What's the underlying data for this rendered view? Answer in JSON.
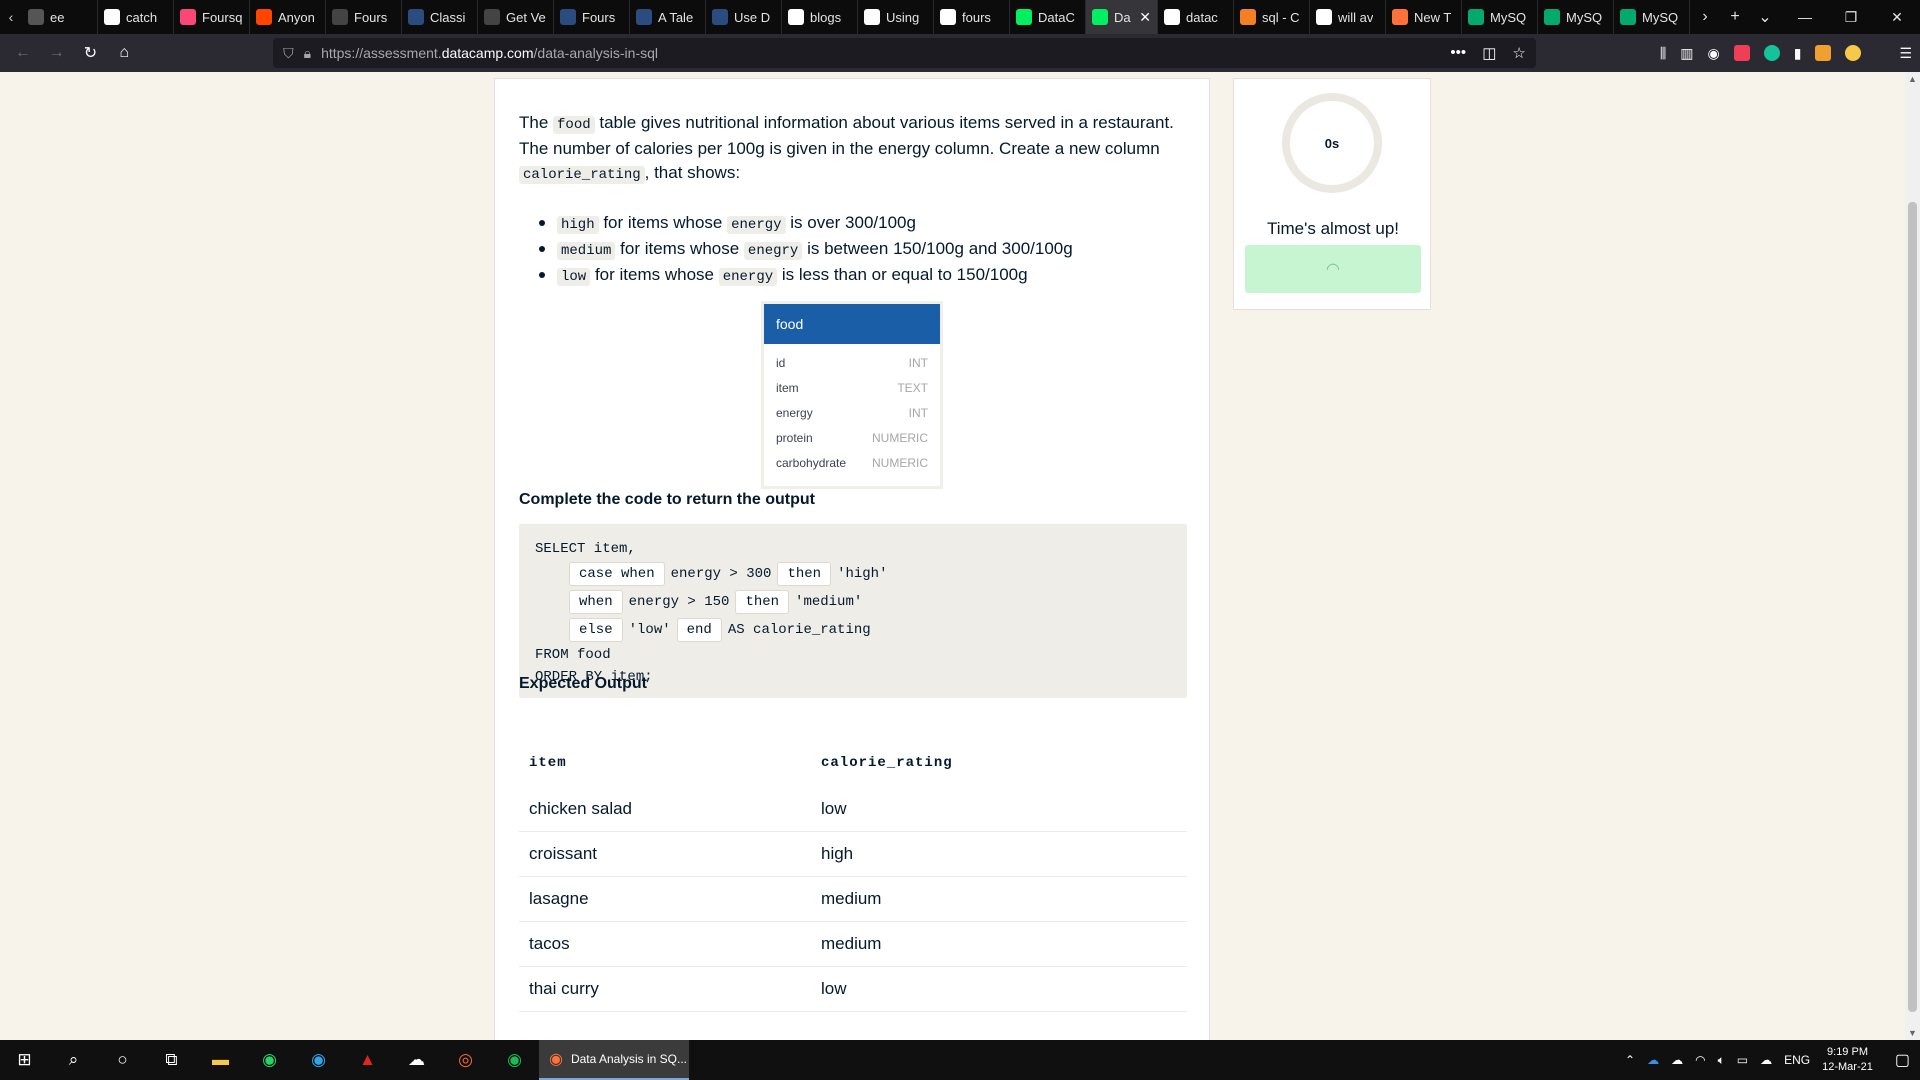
{
  "browser": {
    "tabs": [
      {
        "label": "ee",
        "icon": "generic-icon",
        "color": "#555555"
      },
      {
        "label": "catch",
        "icon": "google-icon",
        "color": "#ffffff"
      },
      {
        "label": "Foursq",
        "icon": "foursquare-icon",
        "color": "#f94877"
      },
      {
        "label": "Anyon",
        "icon": "reddit-icon",
        "color": "#ff4500"
      },
      {
        "label": "Fours",
        "icon": "stackoverflow-icon",
        "color": "#444444"
      },
      {
        "label": "Classi",
        "icon": "tds-icon",
        "color": "#2b4c7e"
      },
      {
        "label": "Get Ve",
        "icon": "stackoverflow-icon",
        "color": "#444444"
      },
      {
        "label": "Fours",
        "icon": "tds-icon",
        "color": "#2b4c7e"
      },
      {
        "label": "A Tale",
        "icon": "tds-icon",
        "color": "#2b4c7e"
      },
      {
        "label": "Use D",
        "icon": "tds-icon",
        "color": "#2b4c7e"
      },
      {
        "label": "blogs",
        "icon": "github-icon",
        "color": "#ffffff"
      },
      {
        "label": "Using",
        "icon": "medium-icon",
        "color": "#ffffff"
      },
      {
        "label": "fours",
        "icon": "google-icon",
        "color": "#ffffff"
      },
      {
        "label": "DataC",
        "icon": "datacamp-icon",
        "color": "#03ef62"
      },
      {
        "label": "Da",
        "icon": "datacamp-icon",
        "color": "#03ef62",
        "active": true
      },
      {
        "label": "datac",
        "icon": "google-icon",
        "color": "#ffffff"
      },
      {
        "label": "sql - C",
        "icon": "stackexchange-icon",
        "color": "#f48024"
      },
      {
        "label": "will av",
        "icon": "google-icon",
        "color": "#ffffff"
      },
      {
        "label": "New T",
        "icon": "firefox-icon",
        "color": "#ff7139"
      },
      {
        "label": "MySQ",
        "icon": "w3schools-icon",
        "color": "#04aa6d"
      },
      {
        "label": "MySQ",
        "icon": "w3schools-icon",
        "color": "#04aa6d"
      },
      {
        "label": "MySQ",
        "icon": "w3schools-icon",
        "color": "#04aa6d"
      }
    ],
    "url_prefix": "https://assessment.",
    "url_host": "datacamp.com",
    "url_path": "/data-analysis-in-sql"
  },
  "question": {
    "intro_1": "The ",
    "table_name": "food",
    "intro_2": " table gives nutritional information about various items served in a restaurant. The number of calories per 100g is given in the energy column. Create a new column ",
    "new_column": "calorie_rating",
    "intro_3": ", that shows:",
    "bullets": [
      {
        "code": "high",
        "text_1": " for items whose ",
        "col": "energy",
        "text_2": " is over 300/100g"
      },
      {
        "code": "medium",
        "text_1": " for items whose ",
        "col": "enegry",
        "text_2": " is between 150/100g and 300/100g"
      },
      {
        "code": "low",
        "text_1": " for items whose ",
        "col": "energy",
        "text_2": " is less than or equal to 150/100g"
      }
    ]
  },
  "schema": {
    "table": "food",
    "columns": [
      {
        "name": "id",
        "type": "INT"
      },
      {
        "name": "item",
        "type": "TEXT"
      },
      {
        "name": "energy",
        "type": "INT"
      },
      {
        "name": "protein",
        "type": "NUMERIC"
      },
      {
        "name": "carbohydrate",
        "type": "NUMERIC"
      }
    ]
  },
  "code_section": {
    "heading": "Complete the code to return the output",
    "line1": "SELECT item,",
    "l2_slot1": "case when",
    "l2_text": "energy > 300",
    "l2_slot2": "then",
    "l2_tail": "'high'",
    "l3_slot1": "when",
    "l3_text": "energy > 150",
    "l3_slot2": "then",
    "l3_tail": "'medium'",
    "l4_slot1": "else",
    "l4_text": "'low'",
    "l4_slot2": "end",
    "l4_tail": "AS calorie_rating",
    "line5": "FROM food",
    "line6": "ORDER BY item;"
  },
  "output": {
    "heading": "Expected Output",
    "columns": [
      "item",
      "calorie_rating"
    ],
    "rows": [
      [
        "chicken salad",
        "low"
      ],
      [
        "croissant",
        "high"
      ],
      [
        "lasagne",
        "medium"
      ],
      [
        "tacos",
        "medium"
      ],
      [
        "thai curry",
        "low"
      ]
    ]
  },
  "timer": {
    "value": "0s",
    "message": "Time's almost up!"
  },
  "taskbar": {
    "active_app": "Data Analysis in SQ...",
    "lang": "ENG",
    "time": "9:19 PM",
    "date": "12-Mar-21"
  }
}
